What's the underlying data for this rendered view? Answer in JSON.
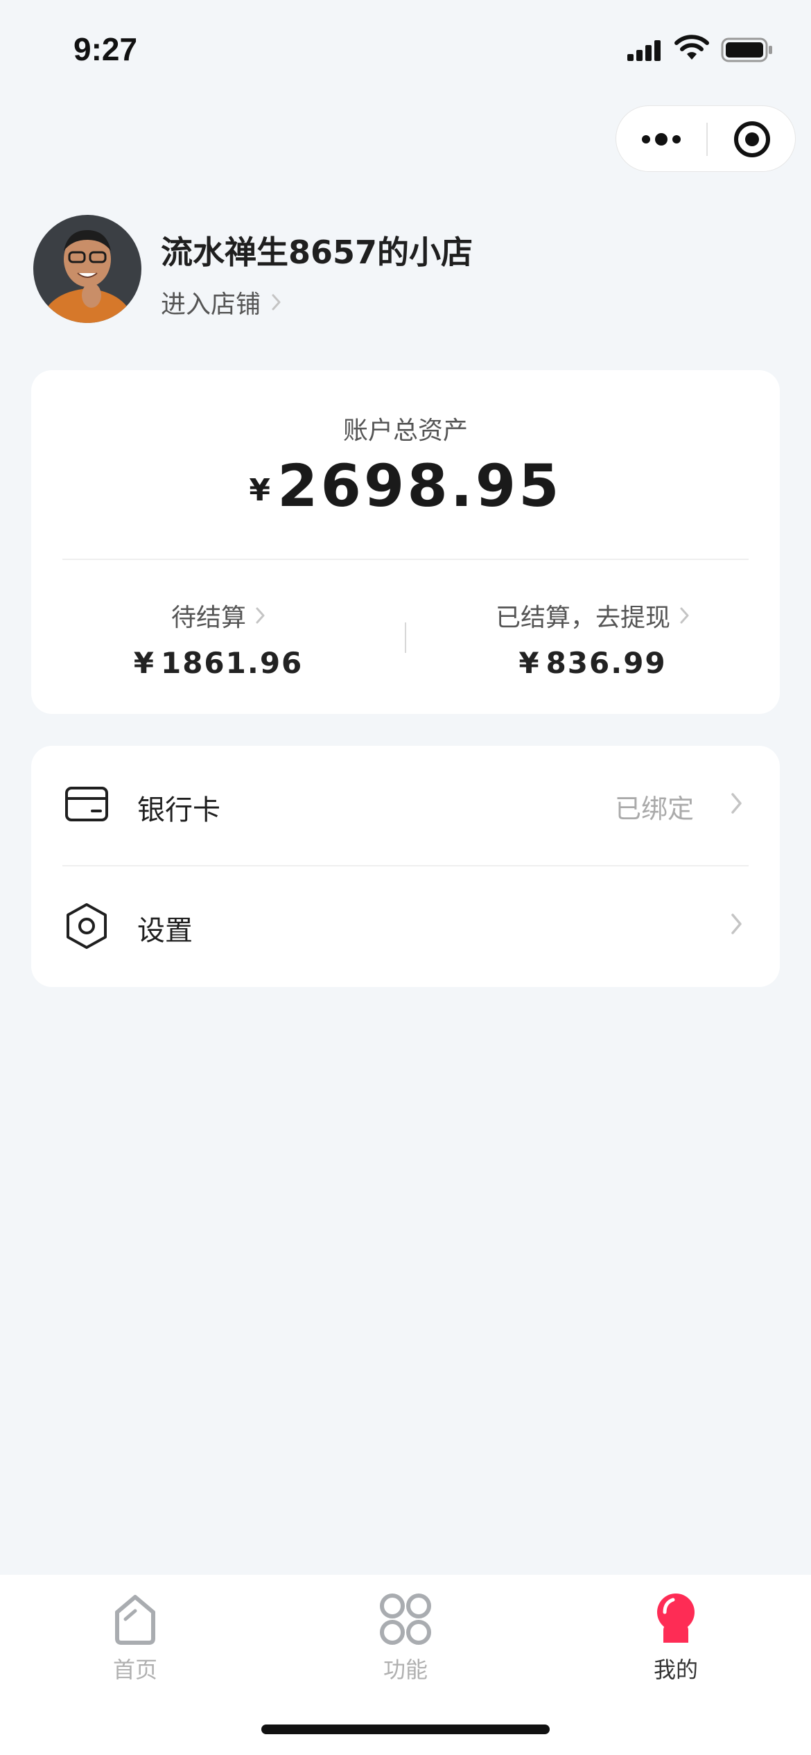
{
  "status_bar": {
    "time": "9:27",
    "icons": [
      "signal-icon",
      "wifi-icon",
      "battery-icon"
    ]
  },
  "capsule": {
    "icons": [
      "more-dots-icon",
      "close-target-icon"
    ]
  },
  "profile": {
    "shop_name": "流水禅生8657的小店",
    "enter_shop_label": "进入店铺"
  },
  "assets": {
    "label": "账户总资产",
    "currency": "¥",
    "total": "2698.95",
    "pending": {
      "label": "待结算",
      "value": "1861.96"
    },
    "settled": {
      "label": "已结算，去提现",
      "value": "836.99"
    }
  },
  "menu": {
    "items": [
      {
        "label": "银行卡",
        "status": "已绑定",
        "icon": "bank-card-icon"
      },
      {
        "label": "设置",
        "status": "",
        "icon": "settings-icon"
      }
    ]
  },
  "tab_bar": {
    "tabs": [
      {
        "label": "首页",
        "icon": "home-icon",
        "active": false
      },
      {
        "label": "功能",
        "icon": "grid-icon",
        "active": false
      },
      {
        "label": "我的",
        "icon": "profile-icon",
        "active": true
      }
    ]
  },
  "colors": {
    "background": "#f3f6f9",
    "card": "#ffffff",
    "accent": "#fe2c55",
    "muted_text": "#aaaaaa"
  }
}
